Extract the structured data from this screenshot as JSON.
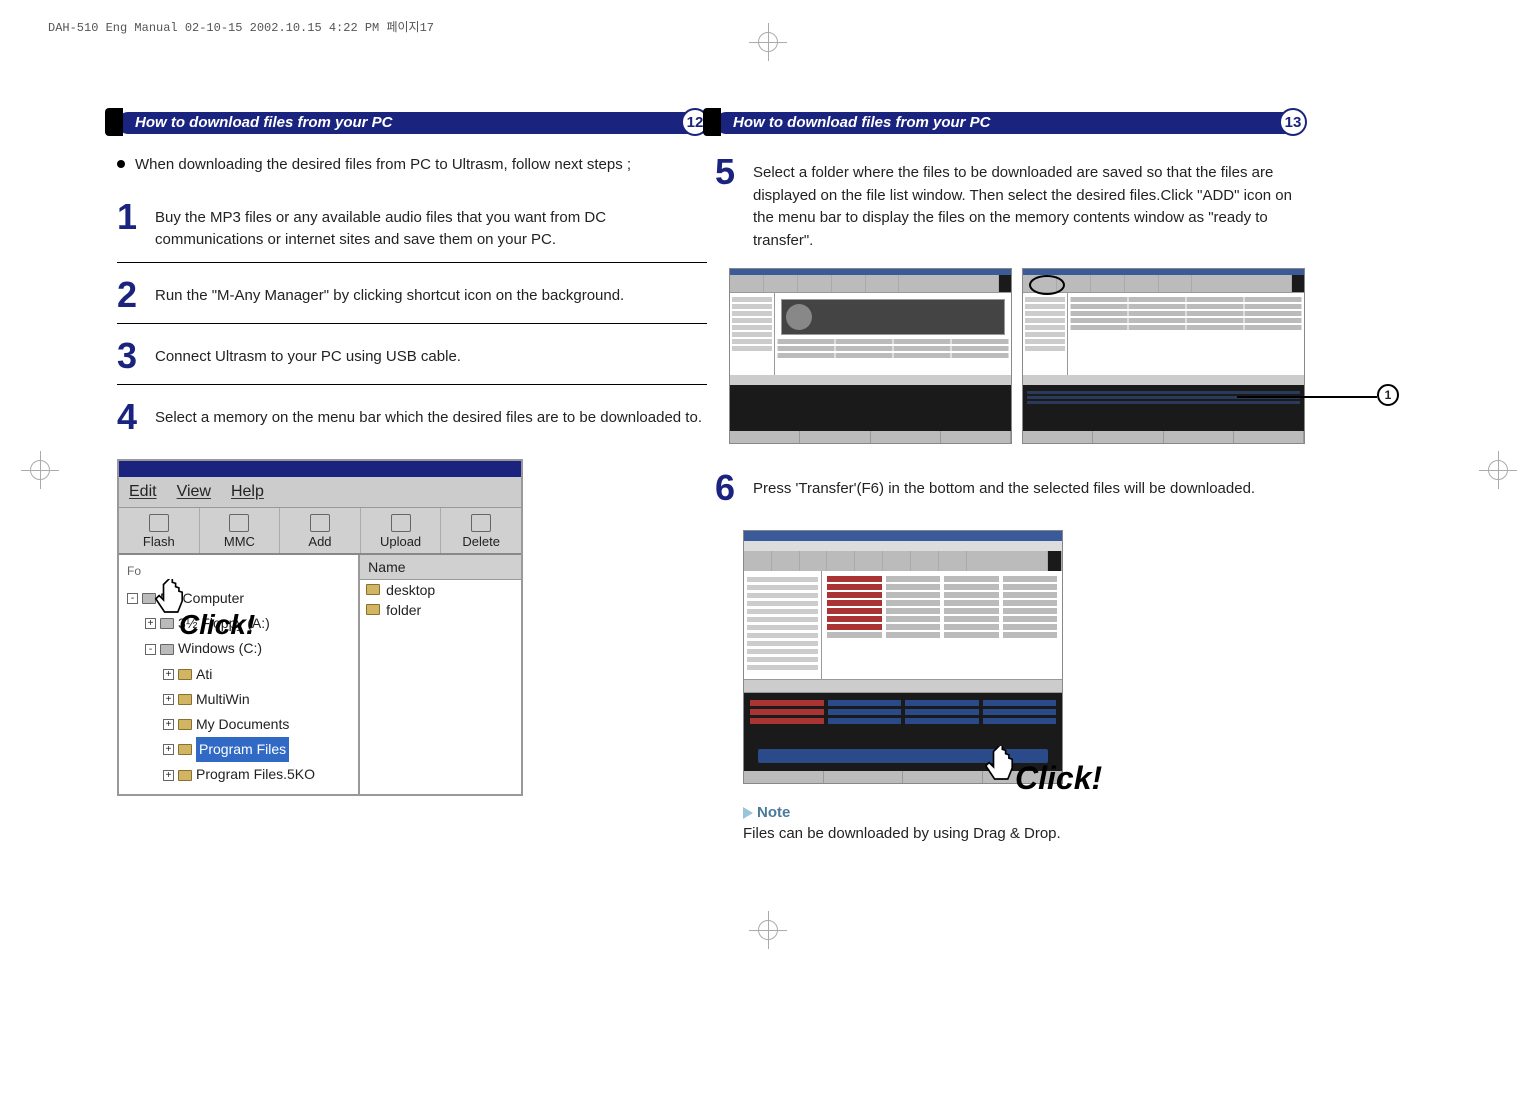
{
  "top_annotation": "DAH-510 Eng Manual 02-10-15  2002.10.15 4:22 PM  페이지17",
  "left": {
    "header": "How to download files from your PC",
    "page_num": "12",
    "bullet": "When downloading the desired files from PC to Ultrasm, follow next steps ;",
    "steps": {
      "s1": {
        "num": "1",
        "text": "Buy the MP3 files or any available audio files that you want from DC communications or internet sites and save them on your PC."
      },
      "s2": {
        "num": "2",
        "text": "Run the \"M-Any Manager\" by clicking shortcut icon on the background."
      },
      "s3": {
        "num": "3",
        "text": "Connect Ultrasm to your PC using USB cable."
      },
      "s4": {
        "num": "4",
        "text": "Select a memory on the menu bar which the desired files are to be downloaded to."
      }
    },
    "app": {
      "menu": {
        "edit": "Edit",
        "view": "View",
        "help": "Help"
      },
      "toolbar": {
        "flash": "Flash",
        "mmc": "MMC",
        "add": "Add",
        "upload": "Upload",
        "delete": "Delete"
      },
      "list_header": "Name",
      "list_items": {
        "i1": "desktop",
        "i2": "folder"
      },
      "tree": {
        "root": "My Computer",
        "floppy": "3½ Floppy (A:)",
        "winc": "Windows (C:)",
        "ati": "Ati",
        "multiwin": "MultiWin",
        "mydocs": "My Documents",
        "progfiles": "Program Files",
        "progfiles5ko": "Program Files.5KO"
      }
    },
    "click_label": "Click!"
  },
  "right": {
    "header": "How to download files from your PC",
    "page_num": "13",
    "steps": {
      "s5": {
        "num": "5",
        "text": "Select a folder where the files to be downloaded are saved so that the files are displayed on the file list window. Then select the desired files.Click \"ADD\" icon on the menu bar to display the files on the memory contents window as \"ready to transfer\"."
      },
      "s6": {
        "num": "6",
        "text": "Press 'Transfer'(F6) in the bottom and the selected files will be downloaded."
      }
    },
    "marker1": "1",
    "click_label": "Click!",
    "note_title": "Note",
    "note_text": "Files can be downloaded by using Drag & Drop."
  }
}
